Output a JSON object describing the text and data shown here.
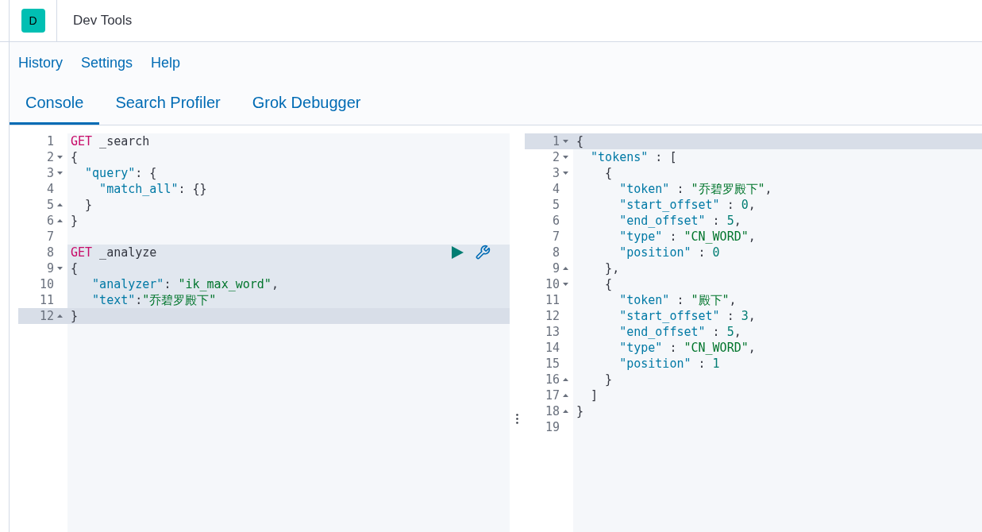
{
  "app": {
    "badge": "D",
    "title": "Dev Tools"
  },
  "menu": [
    "History",
    "Settings",
    "Help"
  ],
  "tabs": [
    {
      "label": "Console",
      "selected": true
    },
    {
      "label": "Search Profiler",
      "selected": false
    },
    {
      "label": "Grok Debugger",
      "selected": false
    }
  ],
  "request_editor": {
    "requests": [
      {
        "selected": false,
        "lines": [
          {
            "number": "1",
            "kind": "plain",
            "cursor": false,
            "tokens": [
              {
                "kind": "method",
                "text": "GET"
              },
              {
                "kind": "url",
                "text": " _search"
              }
            ]
          },
          {
            "number": "2",
            "kind": "fold-start",
            "cursor": false,
            "tokens": [
              {
                "kind": "punct",
                "text": "{"
              }
            ]
          },
          {
            "number": "3",
            "kind": "fold-start",
            "cursor": false,
            "tokens": [
              {
                "kind": "key",
                "text": "  \"query\""
              },
              {
                "kind": "punct",
                "text": ": {"
              }
            ]
          },
          {
            "number": "4",
            "kind": "plain",
            "cursor": false,
            "tokens": [
              {
                "kind": "key",
                "text": "    \"match_all\""
              },
              {
                "kind": "punct",
                "text": ": {}"
              }
            ]
          },
          {
            "number": "5",
            "kind": "fold-end",
            "cursor": false,
            "tokens": [
              {
                "kind": "punct",
                "text": "  }"
              }
            ]
          },
          {
            "number": "6",
            "kind": "fold-end",
            "cursor": false,
            "tokens": [
              {
                "kind": "punct",
                "text": "}"
              }
            ]
          },
          {
            "number": "7",
            "kind": "plain",
            "cursor": false
          }
        ]
      },
      {
        "selected": true,
        "lines": [
          {
            "number": "8",
            "kind": "plain",
            "cursor": false,
            "actions": true,
            "tokens": [
              {
                "kind": "method",
                "text": "GET"
              },
              {
                "kind": "url",
                "text": " _analyze"
              }
            ]
          },
          {
            "number": "9",
            "kind": "fold-start",
            "cursor": false,
            "tokens": [
              {
                "kind": "punct",
                "text": "{"
              }
            ]
          },
          {
            "number": "10",
            "kind": "plain",
            "cursor": false,
            "tokens": [
              {
                "kind": "key",
                "text": "   \"analyzer\""
              },
              {
                "kind": "punct",
                "text": ": "
              },
              {
                "kind": "string",
                "text": "\"ik_max_word\""
              },
              {
                "kind": "punct",
                "text": ","
              }
            ]
          },
          {
            "number": "11",
            "kind": "plain",
            "cursor": false,
            "tokens": [
              {
                "kind": "key",
                "text": "   \"text\""
              },
              {
                "kind": "punct",
                "text": ":"
              },
              {
                "kind": "string",
                "text": "\"乔碧罗殿下\""
              }
            ]
          },
          {
            "number": "12",
            "kind": "fold-end",
            "cursor": true,
            "tokens": [
              {
                "kind": "punct",
                "text": "}"
              }
            ]
          }
        ]
      }
    ]
  },
  "response_editor": {
    "lines": [
      {
        "number": "1",
        "kind": "fold-start",
        "cursor": true,
        "tokens": [
          {
            "kind": "punct",
            "text": "{"
          }
        ]
      },
      {
        "number": "2",
        "kind": "fold-start",
        "cursor": false,
        "tokens": [
          {
            "kind": "key",
            "text": "  \"tokens\""
          },
          {
            "kind": "punct",
            "text": " : ["
          }
        ]
      },
      {
        "number": "3",
        "kind": "fold-start",
        "cursor": false,
        "tokens": [
          {
            "kind": "punct",
            "text": "    {"
          }
        ]
      },
      {
        "number": "4",
        "kind": "plain",
        "cursor": false,
        "tokens": [
          {
            "kind": "key",
            "text": "      \"token\""
          },
          {
            "kind": "punct",
            "text": " : "
          },
          {
            "kind": "string",
            "text": "\"乔碧罗殿下\""
          },
          {
            "kind": "punct",
            "text": ","
          }
        ]
      },
      {
        "number": "5",
        "kind": "plain",
        "cursor": false,
        "tokens": [
          {
            "kind": "key",
            "text": "      \"start_offset\""
          },
          {
            "kind": "punct",
            "text": " : "
          },
          {
            "kind": "number",
            "text": "0"
          },
          {
            "kind": "punct",
            "text": ","
          }
        ]
      },
      {
        "number": "6",
        "kind": "plain",
        "cursor": false,
        "tokens": [
          {
            "kind": "key",
            "text": "      \"end_offset\""
          },
          {
            "kind": "punct",
            "text": " : "
          },
          {
            "kind": "number",
            "text": "5"
          },
          {
            "kind": "punct",
            "text": ","
          }
        ]
      },
      {
        "number": "7",
        "kind": "plain",
        "cursor": false,
        "tokens": [
          {
            "kind": "key",
            "text": "      \"type\""
          },
          {
            "kind": "punct",
            "text": " : "
          },
          {
            "kind": "string",
            "text": "\"CN_WORD\""
          },
          {
            "kind": "punct",
            "text": ","
          }
        ]
      },
      {
        "number": "8",
        "kind": "plain",
        "cursor": false,
        "tokens": [
          {
            "kind": "key",
            "text": "      \"position\""
          },
          {
            "kind": "punct",
            "text": " : "
          },
          {
            "kind": "number",
            "text": "0"
          }
        ]
      },
      {
        "number": "9",
        "kind": "fold-end",
        "cursor": false,
        "tokens": [
          {
            "kind": "punct",
            "text": "    },"
          }
        ]
      },
      {
        "number": "10",
        "kind": "fold-start",
        "cursor": false,
        "tokens": [
          {
            "kind": "punct",
            "text": "    {"
          }
        ]
      },
      {
        "number": "11",
        "kind": "plain",
        "cursor": false,
        "tokens": [
          {
            "kind": "key",
            "text": "      \"token\""
          },
          {
            "kind": "punct",
            "text": " : "
          },
          {
            "kind": "string",
            "text": "\"殿下\""
          },
          {
            "kind": "punct",
            "text": ","
          }
        ]
      },
      {
        "number": "12",
        "kind": "plain",
        "cursor": false,
        "tokens": [
          {
            "kind": "key",
            "text": "      \"start_offset\""
          },
          {
            "kind": "punct",
            "text": " : "
          },
          {
            "kind": "number",
            "text": "3"
          },
          {
            "kind": "punct",
            "text": ","
          }
        ]
      },
      {
        "number": "13",
        "kind": "plain",
        "cursor": false,
        "tokens": [
          {
            "kind": "key",
            "text": "      \"end_offset\""
          },
          {
            "kind": "punct",
            "text": " : "
          },
          {
            "kind": "number",
            "text": "5"
          },
          {
            "kind": "punct",
            "text": ","
          }
        ]
      },
      {
        "number": "14",
        "kind": "plain",
        "cursor": false,
        "tokens": [
          {
            "kind": "key",
            "text": "      \"type\""
          },
          {
            "kind": "punct",
            "text": " : "
          },
          {
            "kind": "string",
            "text": "\"CN_WORD\""
          },
          {
            "kind": "punct",
            "text": ","
          }
        ]
      },
      {
        "number": "15",
        "kind": "plain",
        "cursor": false,
        "tokens": [
          {
            "kind": "key",
            "text": "      \"position\""
          },
          {
            "kind": "punct",
            "text": " : "
          },
          {
            "kind": "number",
            "text": "1"
          }
        ]
      },
      {
        "number": "16",
        "kind": "fold-end",
        "cursor": false,
        "tokens": [
          {
            "kind": "punct",
            "text": "    }"
          }
        ]
      },
      {
        "number": "17",
        "kind": "fold-end",
        "cursor": false,
        "tokens": [
          {
            "kind": "punct",
            "text": "  ]"
          }
        ]
      },
      {
        "number": "18",
        "kind": "fold-end",
        "cursor": false,
        "tokens": [
          {
            "kind": "punct",
            "text": "}"
          }
        ]
      },
      {
        "number": "19",
        "kind": "plain",
        "cursor": false
      }
    ]
  }
}
